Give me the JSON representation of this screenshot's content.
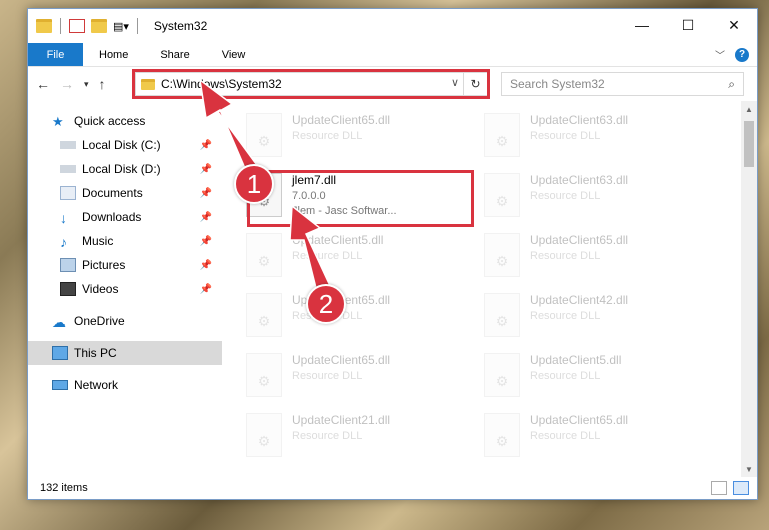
{
  "window": {
    "title": "System32",
    "controls": {
      "minimize": "—",
      "maximize": "☐",
      "close": "✕"
    }
  },
  "ribbon": {
    "file": "File",
    "tabs": [
      "Home",
      "Share",
      "View"
    ]
  },
  "address": {
    "path": "C:\\Windows\\System32",
    "search_placeholder": "Search System32"
  },
  "sidebar": {
    "items": [
      {
        "label": "Quick access",
        "icon": "star-icon",
        "level": 1,
        "pinned": false
      },
      {
        "label": "Local Disk (C:)",
        "icon": "drive-icon",
        "level": 2,
        "pinned": true
      },
      {
        "label": "Local Disk (D:)",
        "icon": "drive-icon",
        "level": 2,
        "pinned": true
      },
      {
        "label": "Documents",
        "icon": "documents-icon",
        "level": 2,
        "pinned": true
      },
      {
        "label": "Downloads",
        "icon": "download-icon",
        "level": 2,
        "pinned": true
      },
      {
        "label": "Music",
        "icon": "music-icon",
        "level": 2,
        "pinned": true
      },
      {
        "label": "Pictures",
        "icon": "pictures-icon",
        "level": 2,
        "pinned": true
      },
      {
        "label": "Videos",
        "icon": "videos-icon",
        "level": 2,
        "pinned": true
      },
      {
        "label": "OneDrive",
        "icon": "cloud-icon",
        "level": 1,
        "pinned": false
      },
      {
        "label": "This PC",
        "icon": "pc-icon",
        "level": 1,
        "pinned": false,
        "selected": true
      },
      {
        "label": "Network",
        "icon": "network-icon",
        "level": 1,
        "pinned": false
      }
    ]
  },
  "files": [
    {
      "name": "UpdateClient65.dll",
      "sub": "Resource DLL",
      "faded": true
    },
    {
      "name": "UpdateClient63.dll",
      "sub": "Resource DLL",
      "faded": true
    },
    {
      "name": "jlem7.dll",
      "sub": "7.0.0.0",
      "sub2": "Jlem - Jasc Softwar...",
      "faded": false
    },
    {
      "name": "UpdateClient63.dll",
      "sub": "Resource DLL",
      "faded": true
    },
    {
      "name": "UpdateClient5.dll",
      "sub": "Resource DLL",
      "faded": true
    },
    {
      "name": "UpdateClient65.dll",
      "sub": "Resource DLL",
      "faded": true
    },
    {
      "name": "UpdateClient65.dll",
      "sub": "Resource DLL",
      "faded": true
    },
    {
      "name": "UpdateClient42.dll",
      "sub": "Resource DLL",
      "faded": true
    },
    {
      "name": "UpdateClient65.dll",
      "sub": "Resource DLL",
      "faded": true
    },
    {
      "name": "UpdateClient5.dll",
      "sub": "Resource DLL",
      "faded": true
    },
    {
      "name": "UpdateClient21.dll",
      "sub": "Resource DLL",
      "faded": true
    },
    {
      "name": "UpdateClient65.dll",
      "sub": "Resource DLL",
      "faded": true
    }
  ],
  "status": {
    "item_count": "132 items"
  },
  "annotations": {
    "step1": "1",
    "step2": "2"
  },
  "colors": {
    "accent": "#1979ca",
    "highlight": "#d9333f"
  }
}
